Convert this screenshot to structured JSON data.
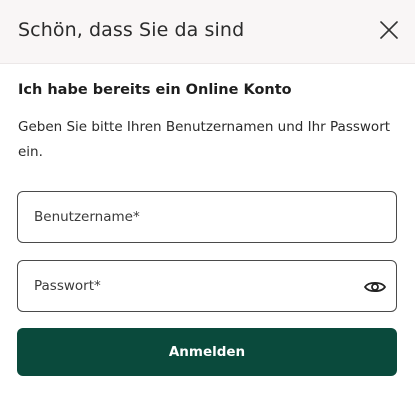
{
  "header": {
    "title": "Schön, dass Sie da sind",
    "close_icon": "close-icon"
  },
  "login": {
    "heading": "Ich habe bereits ein Online Konto",
    "description": "Geben Sie bitte Ihren Benutzernamen und Ihr Passwort ein.",
    "username": {
      "value": "",
      "placeholder": "Benutzername*"
    },
    "password": {
      "value": "",
      "placeholder": "Passwort*",
      "toggle_icon": "eye-icon"
    },
    "submit_label": "Anmelden"
  },
  "colors": {
    "header_bg": "#f9f6f6",
    "primary_button": "#0a4a3c",
    "field_border": "#4a4a4a"
  }
}
